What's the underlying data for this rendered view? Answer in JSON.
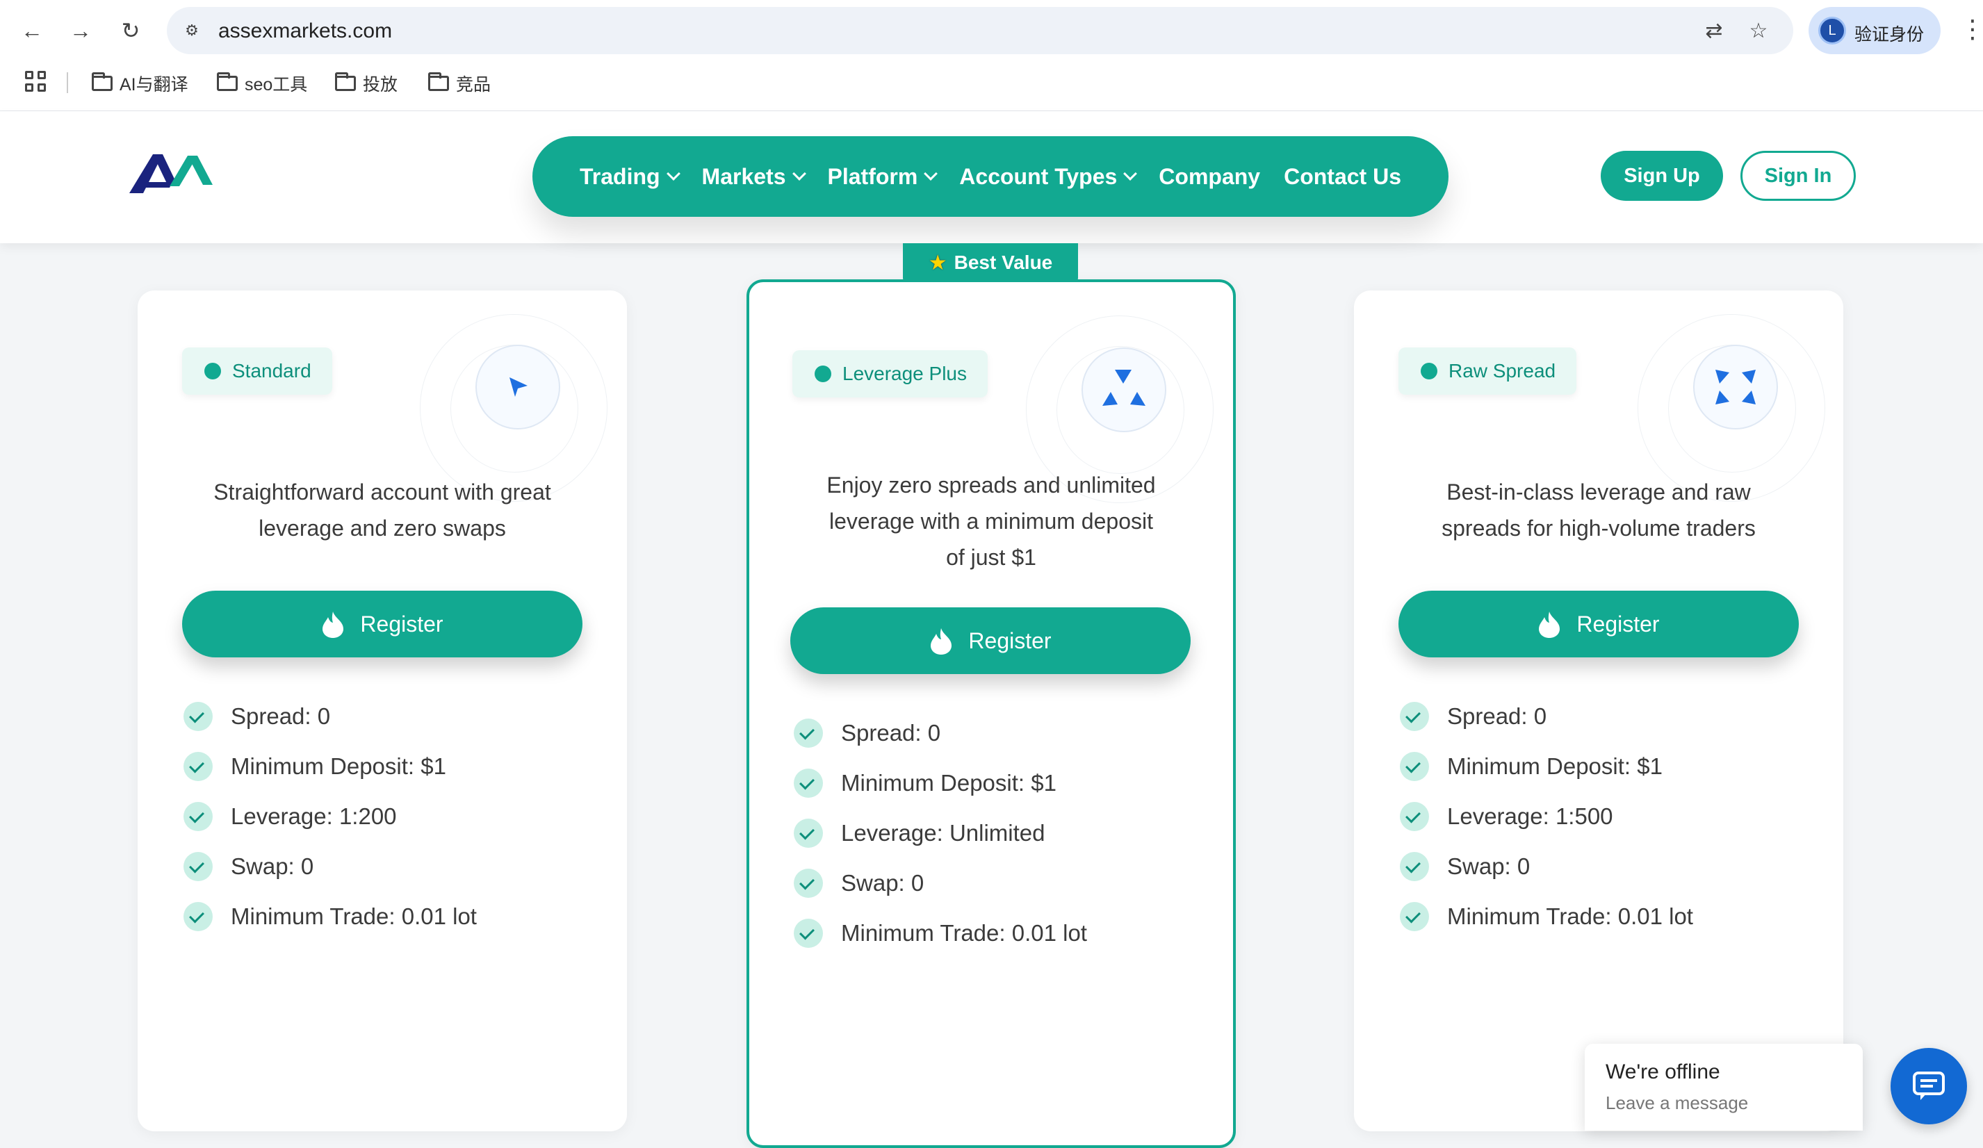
{
  "browser": {
    "url": "assexmarkets.com",
    "profile_label": "验证身份",
    "profile_initial": "L",
    "bookmarks": [
      "AI与翻译",
      "seo工具",
      "投放",
      "竞品"
    ]
  },
  "header": {
    "nav": [
      {
        "label": "Trading",
        "dropdown": true
      },
      {
        "label": "Markets",
        "dropdown": true
      },
      {
        "label": "Platform",
        "dropdown": true
      },
      {
        "label": "Account Types",
        "dropdown": true
      },
      {
        "label": "Company",
        "dropdown": false
      },
      {
        "label": "Contact Us",
        "dropdown": false
      }
    ],
    "signup_label": "Sign Up",
    "signin_label": "Sign In"
  },
  "badge": {
    "label": "Best Value"
  },
  "cards": [
    {
      "name": "Standard",
      "description_lines": [
        "Straightforward account with great",
        "leverage and zero swaps"
      ],
      "button": "Register",
      "features": [
        "Spread: 0",
        "Minimum Deposit: $1",
        "Leverage: 1:200",
        "Swap: 0",
        "Minimum Trade: 0.01 lot"
      ]
    },
    {
      "name": "Leverage Plus",
      "description_lines": [
        "Enjoy zero spreads and unlimited",
        "leverage with a minimum deposit",
        "of just $1"
      ],
      "button": "Register",
      "features": [
        "Spread: 0",
        "Minimum Deposit: $1",
        "Leverage: Unlimited",
        "Swap: 0",
        "Minimum Trade: 0.01 lot"
      ]
    },
    {
      "name": "Raw Spread",
      "description_lines": [
        "Best-in-class leverage and raw",
        "spreads for high-volume traders"
      ],
      "button": "Register",
      "features": [
        "Spread: 0",
        "Minimum Deposit: $1",
        "Leverage: 1:500",
        "Swap: 0",
        "Minimum Trade: 0.01 lot"
      ]
    }
  ],
  "chat": {
    "title": "We're offline",
    "subtitle": "Leave a message"
  },
  "colors": {
    "accent": "#12a991",
    "icon_blue": "#1f6fe0",
    "chat_blue": "#1269d3"
  }
}
